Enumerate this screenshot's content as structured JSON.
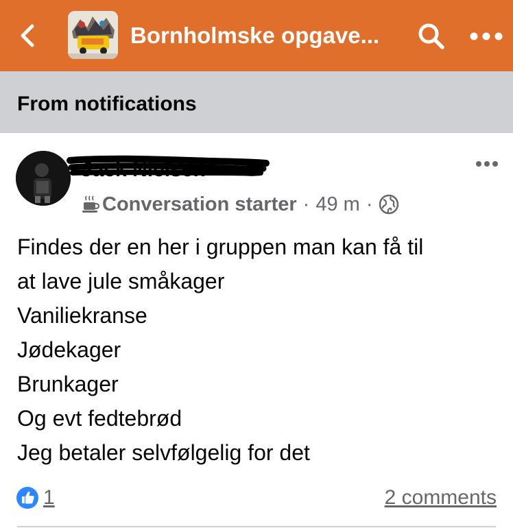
{
  "header": {
    "title": "Bornholmske opgave...",
    "back_icon": "chevron-left-icon",
    "search_icon": "search-icon",
    "more_icon": "more-horizontal-icon",
    "background_color": "#e06f2c"
  },
  "notification_bar": {
    "label": "From notifications"
  },
  "post": {
    "author_name": "Jack Nielsen",
    "badge_icon": "coffee-cup-icon",
    "badge_label": "Conversation starter",
    "time": "49 m",
    "separator": "·",
    "audience_icon": "globe-icon",
    "body_lines": [
      "Findes der en her i gruppen man kan få til",
      "at lave jule småkager",
      "Vaniliekranse",
      "Jødekager",
      "Brunkager",
      "Og evt fedtebrød",
      "Jeg betaler selvfølgelig for det"
    ],
    "reactions": {
      "icon": "like-icon",
      "count": "1"
    },
    "comments_label": "2 comments"
  }
}
